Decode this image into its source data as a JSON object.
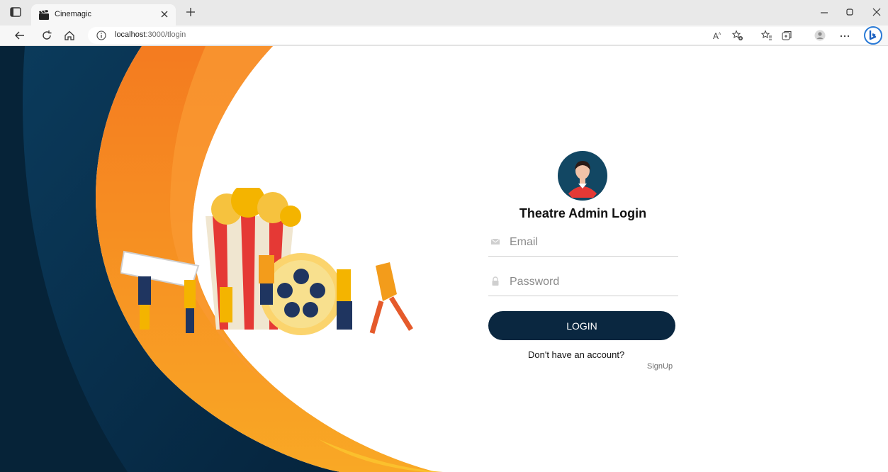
{
  "browser": {
    "tab": {
      "title": "Cinemagic"
    },
    "address": {
      "host": "localhost",
      "path": ":3000/tlogin"
    }
  },
  "icons": {
    "tab_actions": "tab-actions-icon",
    "favicon": "clapperboard-icon",
    "tab_close": "close-icon",
    "new_tab": "plus-icon",
    "minimize": "minimize-icon",
    "restore": "restore-icon",
    "window_close": "close-icon",
    "back": "back-arrow-icon",
    "refresh": "refresh-icon",
    "home": "home-icon",
    "info": "info-icon",
    "read_aloud": "read-aloud-icon",
    "add_favorite": "add-favorite-icon",
    "favorites": "favorites-icon",
    "collections": "collections-icon",
    "profile": "profile-icon",
    "more": "more-icon",
    "bing": "bing-icon",
    "email": "envelope-icon",
    "password": "lock-icon",
    "avatar": "user-avatar-icon"
  },
  "login": {
    "title": "Theatre Admin Login",
    "email_placeholder": "Email",
    "password_placeholder": "Password",
    "button_label": "LOGIN",
    "no_account_text": "Don't have an account?",
    "signup_label": "SignUp"
  },
  "colors": {
    "navy": "#0a2740",
    "orange": "#f58a23",
    "yellow": "#fbc02d",
    "avatar_bg": "#124763"
  }
}
